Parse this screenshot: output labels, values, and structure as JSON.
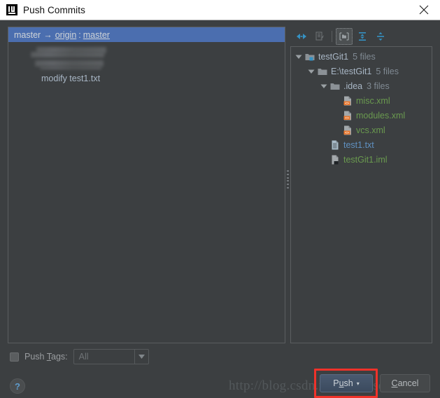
{
  "window": {
    "title": "Push Commits",
    "app_icon": "intellij-idea-icon",
    "close_icon": "close-icon"
  },
  "commit_list": {
    "header": {
      "local_branch": "master",
      "arrow": "→",
      "remote_name": "origin",
      "separator": ":",
      "remote_branch": "master"
    },
    "redacted_lines": 2,
    "commits": [
      {
        "message": "modify test1.txt"
      }
    ]
  },
  "tree_toolbar": {
    "buttons": [
      {
        "name": "collapse-inward-icon",
        "label": "",
        "selected": false,
        "enabled": true
      },
      {
        "name": "show-diff-icon",
        "label": "",
        "selected": false,
        "enabled": false
      },
      {
        "name": "group-by-directory-icon",
        "label": "",
        "selected": true,
        "enabled": true
      },
      {
        "name": "expand-all-icon",
        "label": "",
        "selected": false,
        "enabled": true
      },
      {
        "name": "collapse-all-icon",
        "label": "",
        "selected": false,
        "enabled": true
      }
    ]
  },
  "file_tree": {
    "nodes": [
      {
        "depth": 0,
        "icon": "module-folder-icon",
        "label": "testGit1",
        "count": "5 files",
        "color": "default",
        "expanded": true
      },
      {
        "depth": 1,
        "icon": "folder-icon",
        "label": "E:\\testGit1",
        "count": "5 files",
        "color": "default",
        "expanded": true
      },
      {
        "depth": 2,
        "icon": "folder-icon",
        "label": ".idea",
        "count": "3 files",
        "color": "default",
        "expanded": true
      },
      {
        "depth": 3,
        "icon": "xml-file-icon",
        "label": "misc.xml",
        "count": "",
        "color": "green",
        "expanded": null
      },
      {
        "depth": 3,
        "icon": "xml-file-icon",
        "label": "modules.xml",
        "count": "",
        "color": "green",
        "expanded": null
      },
      {
        "depth": 3,
        "icon": "xml-file-icon",
        "label": "vcs.xml",
        "count": "",
        "color": "green",
        "expanded": null
      },
      {
        "depth": 2,
        "icon": "text-file-icon",
        "label": "test1.txt",
        "count": "",
        "color": "blue",
        "expanded": null
      },
      {
        "depth": 2,
        "icon": "iml-file-icon",
        "label": "testGit1.iml",
        "count": "",
        "color": "green",
        "expanded": null
      }
    ]
  },
  "push_tags": {
    "checked": false,
    "label_pre": "Push ",
    "label_mnemonic": "T",
    "label_post": "ags:",
    "combo_value": "All",
    "combo_enabled": false,
    "arrow_icon": "chevron-down-icon"
  },
  "footer": {
    "help_icon": "help-icon",
    "help_label": "?",
    "push_label_pre": "P",
    "push_label_mnemonic": "u",
    "push_label_post": "sh",
    "push_dropdown_icon": "chevron-down-icon",
    "cancel_label_pre": "",
    "cancel_label_mnemonic": "C",
    "cancel_label_post": "ancel"
  },
  "annotation": {
    "highlight_color": "#f0322a",
    "target": "push-button"
  },
  "watermark": {
    "text": "http://blog.csdn.net/gxx_csdn"
  },
  "colors": {
    "dialog_bg": "#3c3f41",
    "panel_border": "#5b5e60",
    "selection_blue": "#4b6eaf",
    "text_default": "#a9b7c6",
    "text_muted": "#808a93",
    "green": "#6a9a4f",
    "blue": "#5f90c0",
    "accent_icon": "#3592c4",
    "titlebar_bg": "#ffffff"
  }
}
